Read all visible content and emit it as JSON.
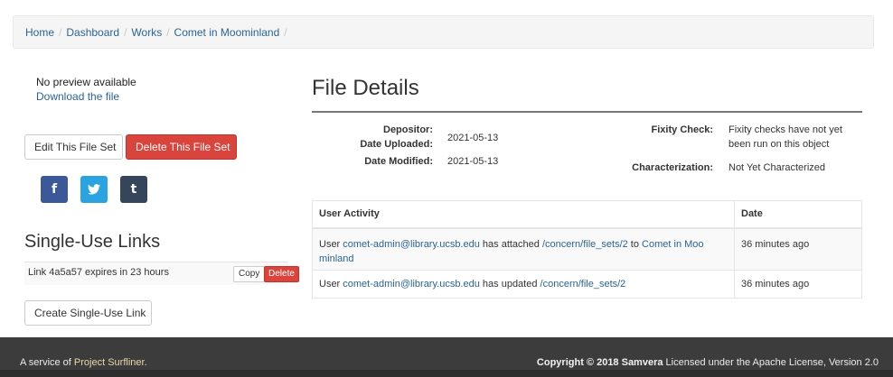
{
  "breadcrumb": {
    "items": [
      "Home",
      "Dashboard",
      "Works",
      "Comet in Moominland"
    ],
    "separator": "/"
  },
  "preview": {
    "no_preview": "No preview available",
    "download": "Download the file"
  },
  "actions": {
    "edit": "Edit This File Set",
    "delete": "Delete This File Set"
  },
  "share": {
    "facebook": "f",
    "twitter": "🐦",
    "tumblr": "t"
  },
  "single_use": {
    "heading": "Single-Use Links",
    "link_text": "Link 4a5a57 expires in 23 hours",
    "copy": "Copy",
    "delete": "Delete",
    "create": "Create Single-Use Link"
  },
  "details": {
    "heading": "File Details",
    "depositor_label": "Depositor:",
    "depositor_value": "",
    "uploaded_label": "Date Uploaded:",
    "uploaded_value": "2021-05-13",
    "modified_label": "Date Modified:",
    "modified_value": "2021-05-13",
    "fixity_label": "Fixity Check:",
    "fixity_value_line1": "Fixity checks have not yet",
    "fixity_value_line2": "been run on this object",
    "characterization_label": "Characterization:",
    "characterization_value": "Not Yet Characterized"
  },
  "activity": {
    "headers": [
      "User Activity",
      "Date"
    ],
    "rows": [
      {
        "user_prefix": "User ",
        "user": "comet-admin@library.ucsb.edu",
        "action": " has attached ",
        "target": "/concern/file_sets/2",
        "to": " to ",
        "work_line1": "Comet in Moo",
        "work_line2": "minland",
        "date": "36 minutes ago"
      },
      {
        "user_prefix": "User ",
        "user": "comet-admin@library.ucsb.edu",
        "action": " has updated ",
        "target": "/concern/file_sets/2",
        "date": "36 minutes ago"
      }
    ]
  },
  "footer": {
    "service_prefix": "A service of ",
    "service_link": "Project Surfliner.",
    "copyright": "Copyright © 2018 Samvera",
    "license": " Licensed under the Apache License, Version 2.0"
  },
  "colors": {
    "link": "#2a6496",
    "danger": "#d9453d",
    "footer_bg": "#3c3c3c"
  }
}
